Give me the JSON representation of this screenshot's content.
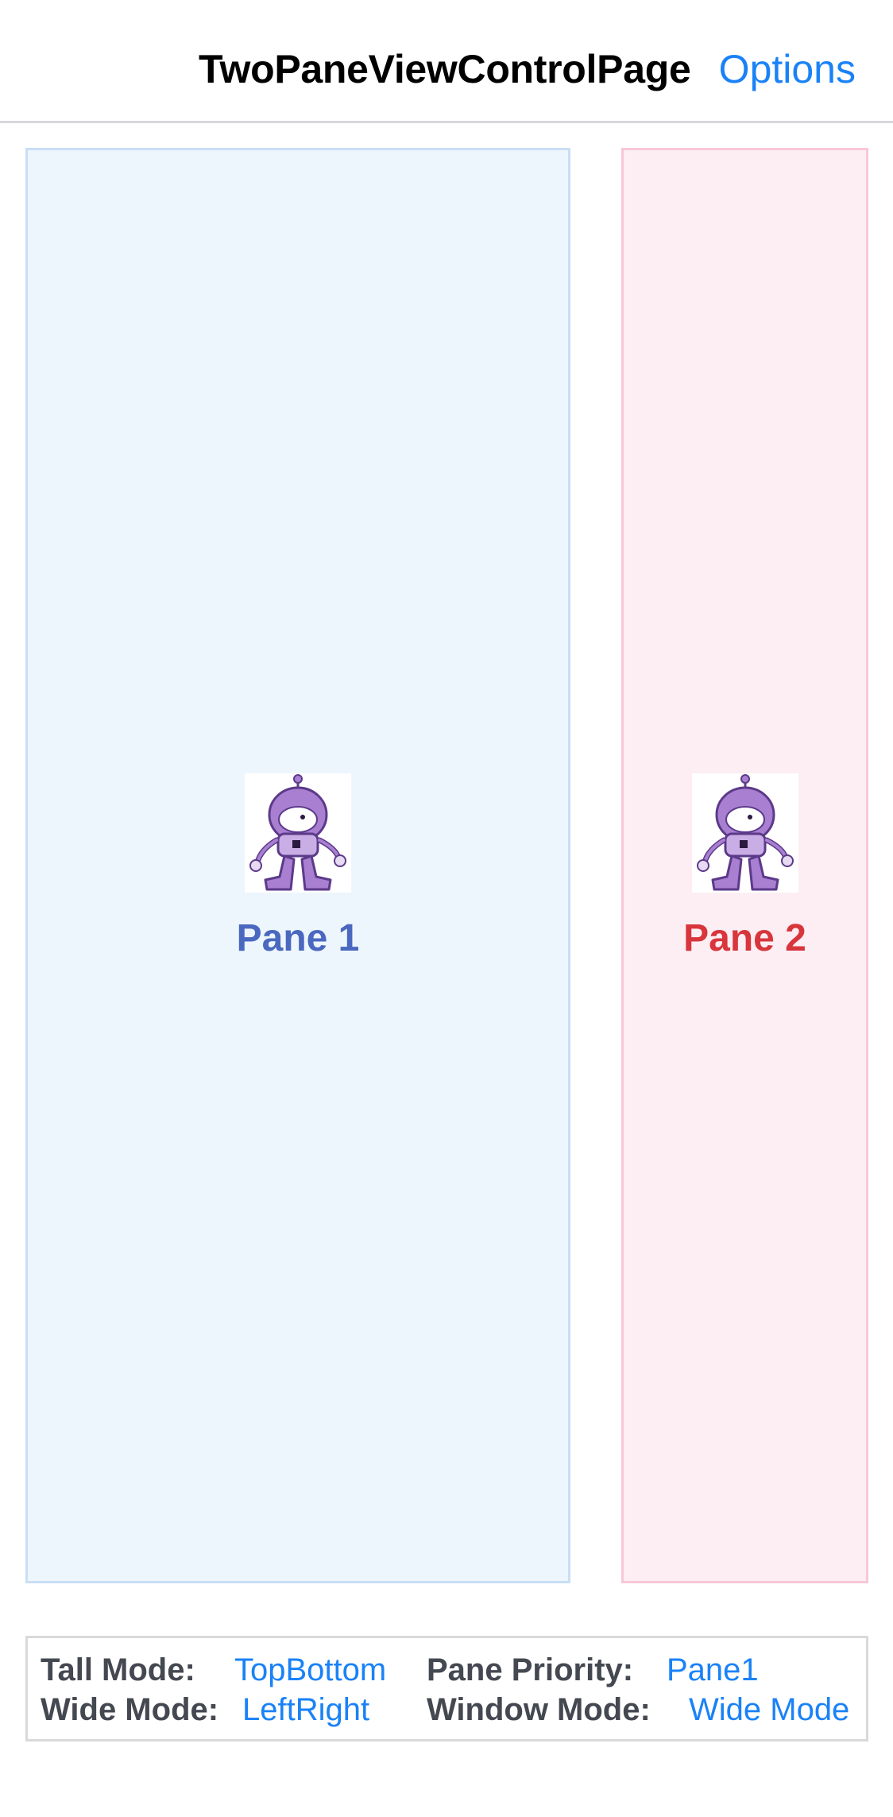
{
  "header": {
    "title": "TwoPaneViewControlPage",
    "options_label": "Options"
  },
  "panes": [
    {
      "label": "Pane 1",
      "color": "#4a68bf",
      "background": "#eef6fd",
      "icon": "dotnet-bot-icon"
    },
    {
      "label": "Pane 2",
      "color": "#d8353c",
      "background": "#fdeef3",
      "icon": "dotnet-bot-icon"
    }
  ],
  "info": {
    "tall_mode_label": "Tall Mode:",
    "tall_mode_value": "TopBottom",
    "wide_mode_label": "Wide Mode:",
    "wide_mode_value": "LeftRight",
    "pane_priority_label": "Pane Priority:",
    "pane_priority_value": "Pane1",
    "window_mode_label": "Window Mode:",
    "window_mode_value": "Wide Mode"
  },
  "colors": {
    "accent": "#1a82f7",
    "label_text": "#444851"
  }
}
